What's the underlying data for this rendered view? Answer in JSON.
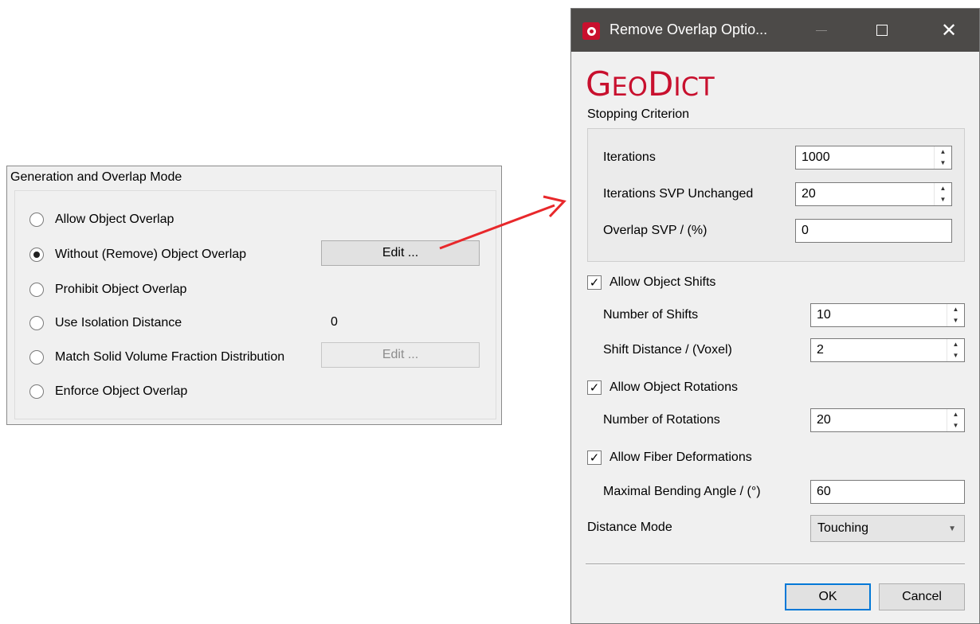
{
  "left_panel": {
    "title": "Generation and Overlap Mode",
    "options": [
      {
        "label": "Allow Object Overlap",
        "checked": false
      },
      {
        "label": "Without (Remove) Object Overlap",
        "checked": true
      },
      {
        "label": "Prohibit Object Overlap",
        "checked": false
      },
      {
        "label": "Use Isolation Distance",
        "checked": false
      },
      {
        "label": "Match Solid Volume Fraction Distribution",
        "checked": false
      },
      {
        "label": "Enforce Object Overlap",
        "checked": false
      }
    ],
    "edit_button_label": "Edit ...",
    "edit_button_disabled_label": "Edit ...",
    "isolation_distance_value": "0"
  },
  "dialog": {
    "title": "Remove Overlap Optio...",
    "logo": {
      "part1_big": "G",
      "part1_small": "EO",
      "part2_big": "D",
      "part2_small": "ICT"
    },
    "stopping_criterion_label": "Stopping Criterion",
    "iterations_label": "Iterations",
    "iterations_value": "1000",
    "iterations_svp_label": "Iterations SVP Unchanged",
    "iterations_svp_value": "20",
    "overlap_svp_label": "Overlap SVP / (%)",
    "overlap_svp_value": "0",
    "allow_shifts_label": "Allow Object Shifts",
    "allow_shifts_checked": true,
    "number_of_shifts_label": "Number of Shifts",
    "number_of_shifts_value": "10",
    "shift_distance_label": "Shift Distance / (Voxel)",
    "shift_distance_value": "2",
    "allow_rotations_label": "Allow Object Rotations",
    "allow_rotations_checked": true,
    "number_of_rotations_label": "Number of Rotations",
    "number_of_rotations_value": "20",
    "allow_fiber_label": "Allow Fiber Deformations",
    "allow_fiber_checked": true,
    "max_bending_label": "Maximal Bending Angle / (°)",
    "max_bending_value": "60",
    "distance_mode_label": "Distance Mode",
    "distance_mode_value": "Touching",
    "ok_label": "OK",
    "cancel_label": "Cancel",
    "check_glyph": "✓",
    "close_glyph": "✕",
    "spin_up_glyph": "▲",
    "spin_down_glyph": "▼",
    "combo_arrow_glyph": "▼"
  },
  "colors": {
    "brand_red": "#c8102e",
    "titlebar": "#4c4a48",
    "arrow": "#e8282b",
    "focus_blue": "#0078d7"
  }
}
